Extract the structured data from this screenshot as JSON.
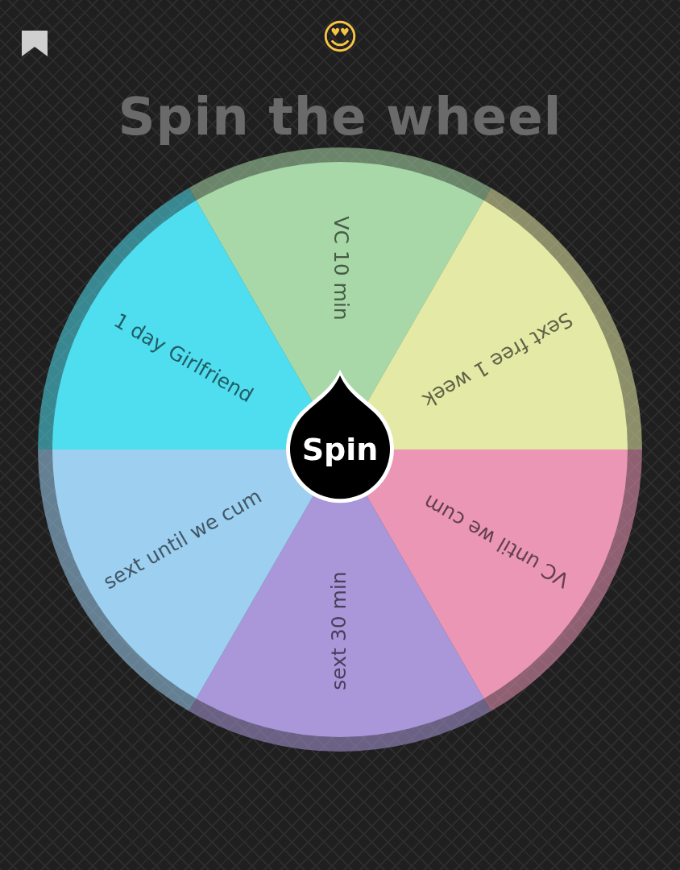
{
  "emoji": "😍",
  "title": "Spin the wheel",
  "wheel": {
    "segments": [
      {
        "label": "VC 10 min",
        "color": "#a8d8a8"
      },
      {
        "label": "Sext free 1 week",
        "color": "#e4eaa6"
      },
      {
        "label": "VC until we cum",
        "color": "#ea96b4"
      },
      {
        "label": "sext 30 min",
        "color": "#a997d9"
      },
      {
        "label": "sext until we cum",
        "color": "#9ccff0"
      },
      {
        "label": "1 day Girlfriend",
        "color": "#4fdeef"
      }
    ]
  },
  "spin_button": "Spin"
}
